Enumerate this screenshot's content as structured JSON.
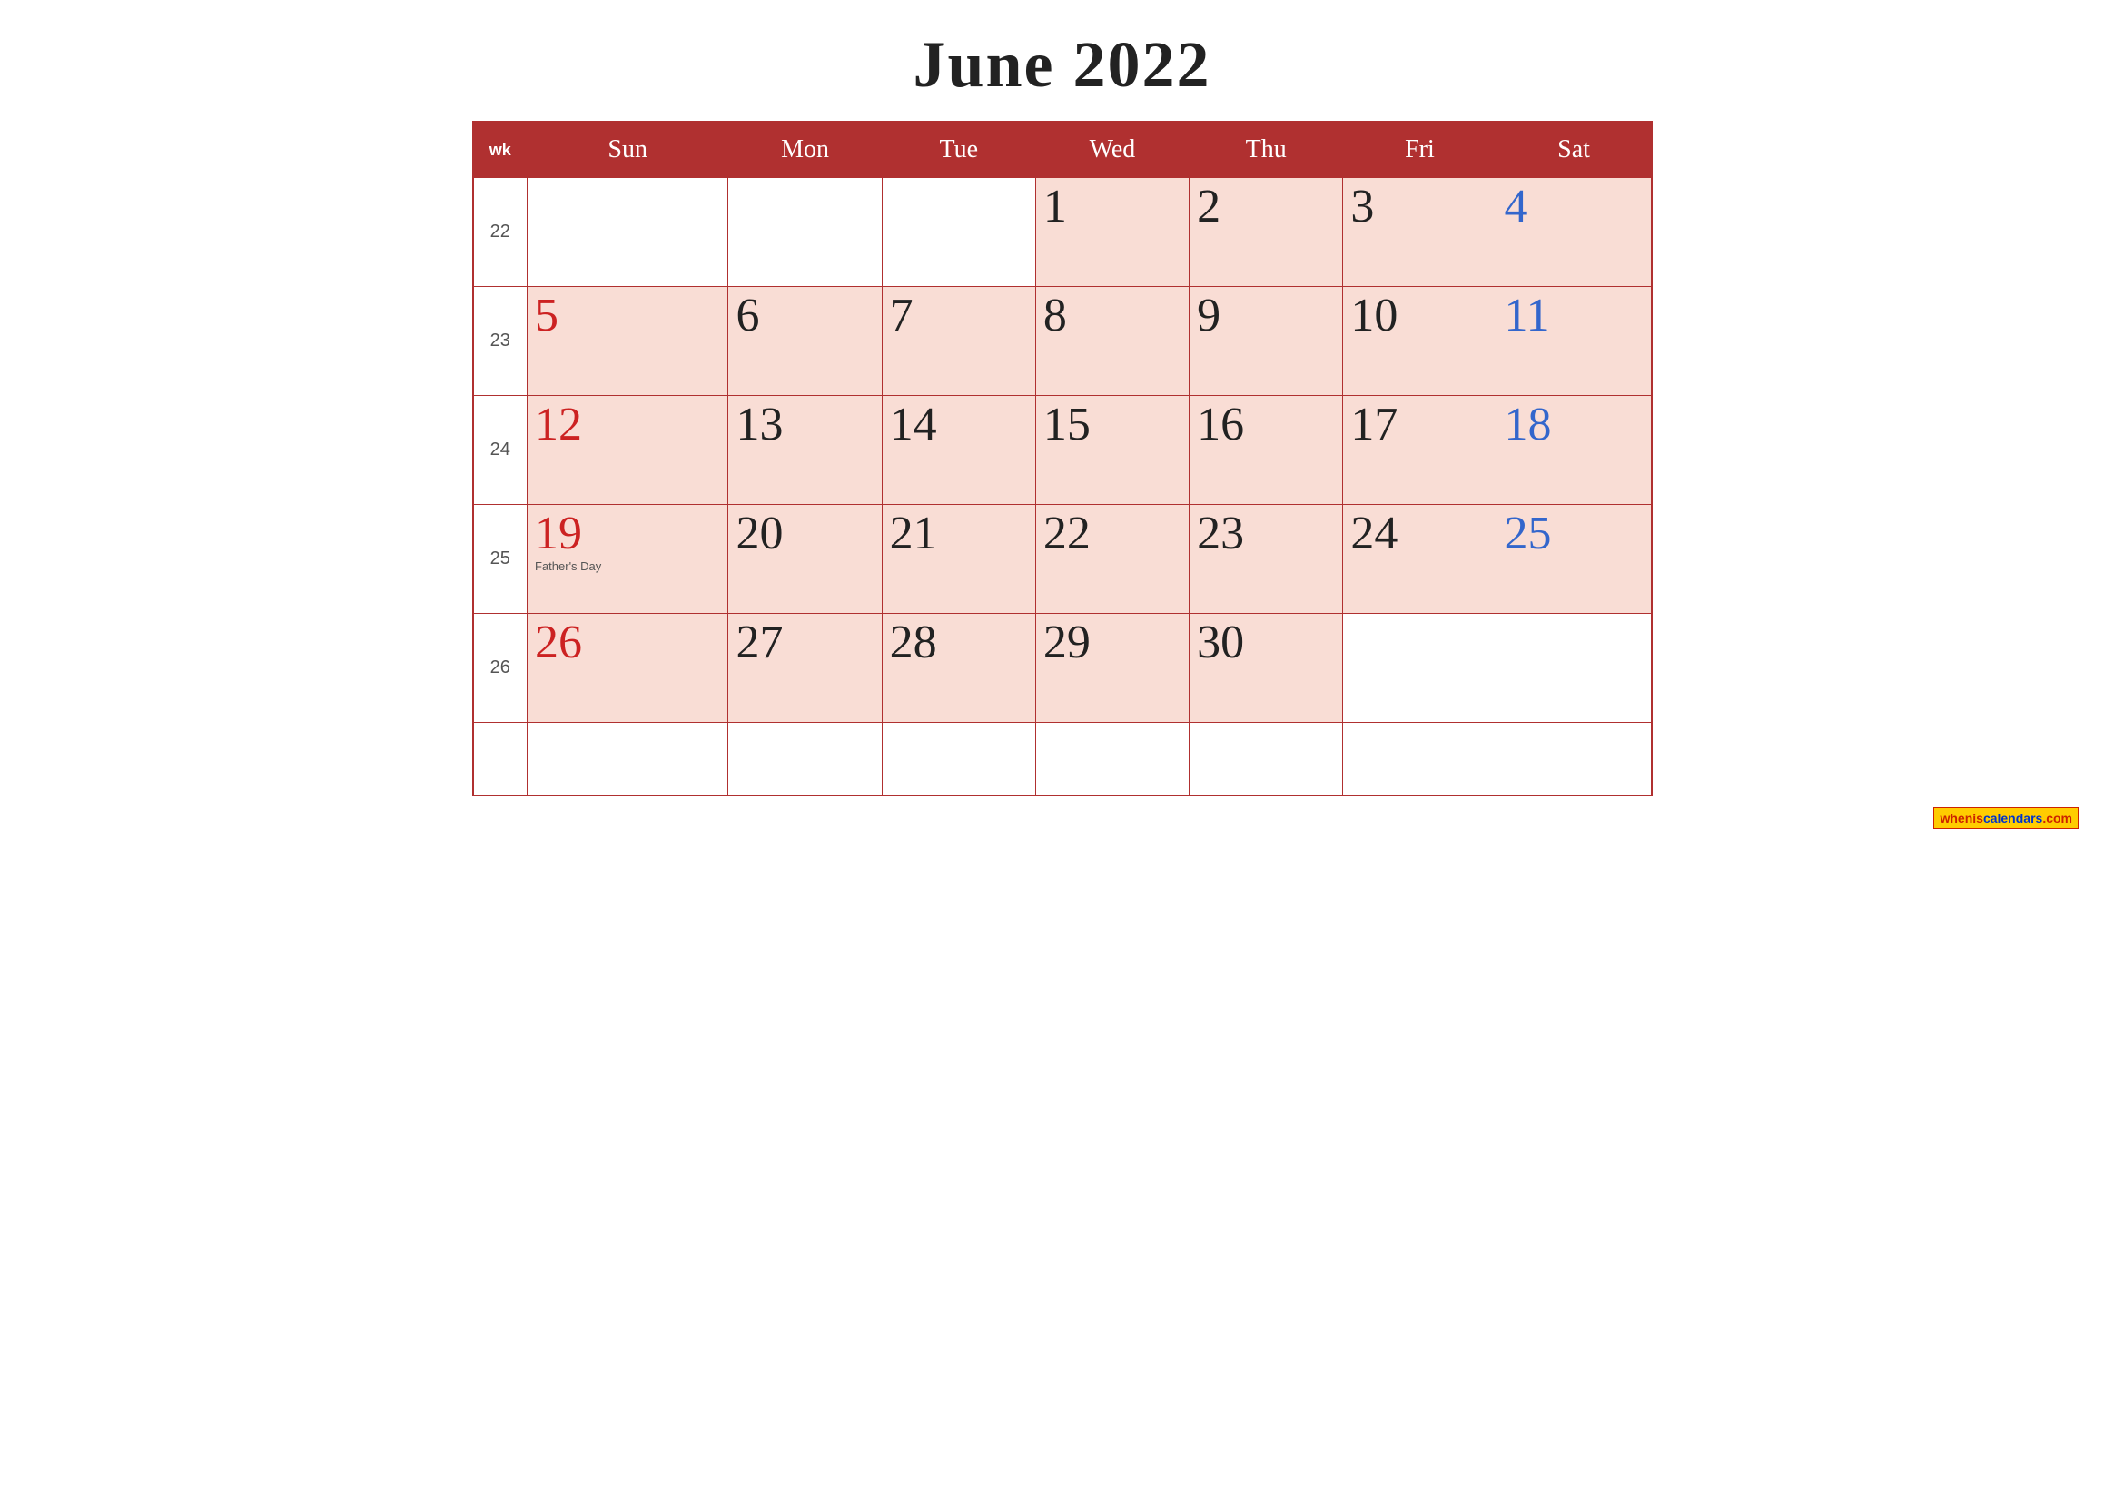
{
  "title": "June 2022",
  "header": {
    "wk": "wk",
    "days": [
      "Sun",
      "Mon",
      "Tue",
      "Wed",
      "Thu",
      "Fri",
      "Sat"
    ]
  },
  "weeks": [
    {
      "wk": "22",
      "days": [
        {
          "num": "",
          "type": "empty"
        },
        {
          "num": "",
          "type": "empty"
        },
        {
          "num": "",
          "type": "empty"
        },
        {
          "num": "1",
          "type": "normal"
        },
        {
          "num": "2",
          "type": "normal"
        },
        {
          "num": "3",
          "type": "normal"
        },
        {
          "num": "4",
          "type": "saturday"
        }
      ]
    },
    {
      "wk": "23",
      "days": [
        {
          "num": "5",
          "type": "sunday"
        },
        {
          "num": "6",
          "type": "normal"
        },
        {
          "num": "7",
          "type": "normal"
        },
        {
          "num": "8",
          "type": "normal"
        },
        {
          "num": "9",
          "type": "normal"
        },
        {
          "num": "10",
          "type": "normal"
        },
        {
          "num": "11",
          "type": "saturday"
        }
      ]
    },
    {
      "wk": "24",
      "days": [
        {
          "num": "12",
          "type": "sunday"
        },
        {
          "num": "13",
          "type": "normal"
        },
        {
          "num": "14",
          "type": "normal"
        },
        {
          "num": "15",
          "type": "normal"
        },
        {
          "num": "16",
          "type": "normal"
        },
        {
          "num": "17",
          "type": "normal"
        },
        {
          "num": "18",
          "type": "saturday"
        }
      ]
    },
    {
      "wk": "25",
      "days": [
        {
          "num": "19",
          "type": "sunday",
          "holiday": "Father's Day"
        },
        {
          "num": "20",
          "type": "normal"
        },
        {
          "num": "21",
          "type": "normal"
        },
        {
          "num": "22",
          "type": "normal"
        },
        {
          "num": "23",
          "type": "normal"
        },
        {
          "num": "24",
          "type": "normal"
        },
        {
          "num": "25",
          "type": "saturday"
        }
      ]
    },
    {
      "wk": "26",
      "days": [
        {
          "num": "26",
          "type": "sunday"
        },
        {
          "num": "27",
          "type": "normal"
        },
        {
          "num": "28",
          "type": "normal"
        },
        {
          "num": "29",
          "type": "normal"
        },
        {
          "num": "30",
          "type": "normal"
        },
        {
          "num": "",
          "type": "empty"
        },
        {
          "num": "",
          "type": "empty"
        }
      ]
    },
    {
      "wk": "",
      "days": [
        {
          "num": "",
          "type": "last-row"
        },
        {
          "num": "",
          "type": "last-row"
        },
        {
          "num": "",
          "type": "last-row"
        },
        {
          "num": "",
          "type": "last-row"
        },
        {
          "num": "",
          "type": "last-row"
        },
        {
          "num": "",
          "type": "last-row"
        },
        {
          "num": "",
          "type": "last-row"
        }
      ]
    }
  ],
  "watermark": {
    "text1": "whenis",
    "text2": "calendars",
    "text3": ".com"
  }
}
